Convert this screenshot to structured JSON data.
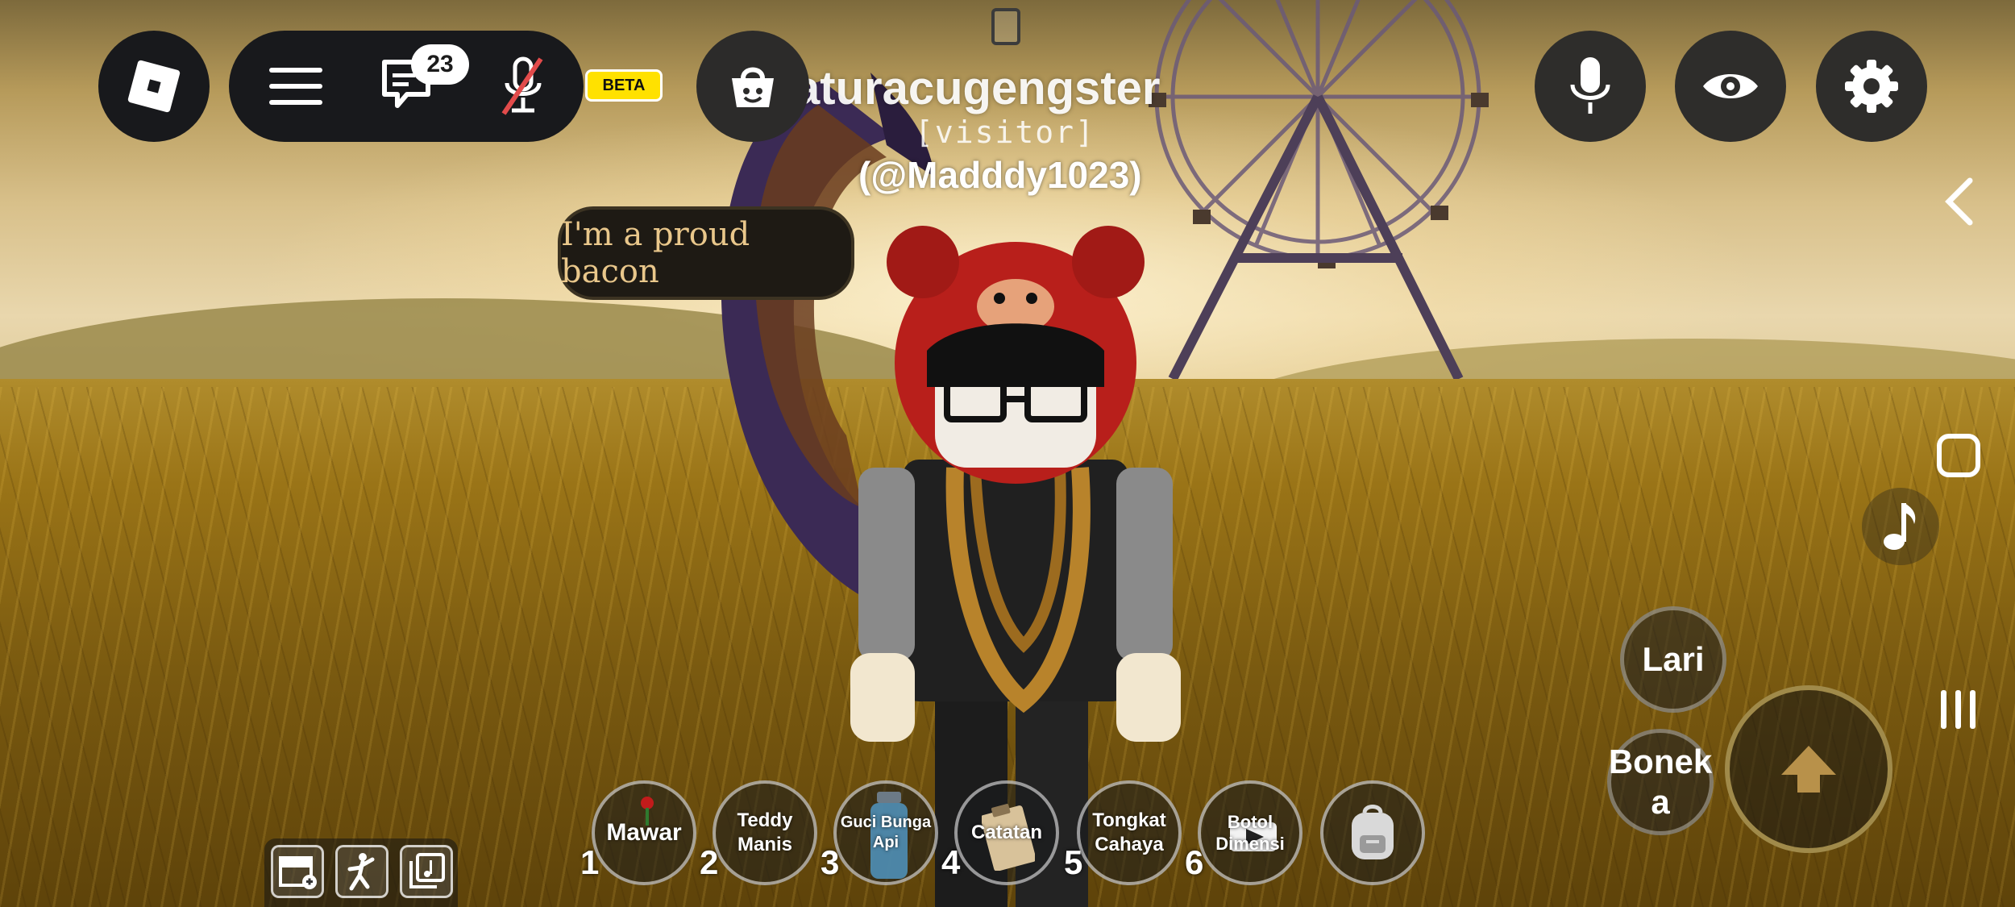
{
  "player": {
    "display_name": "aturacugengster",
    "role": "[visitor]",
    "handle": "(@Madddy1023)"
  },
  "chat_bubble": {
    "text": "I'm a proud bacon"
  },
  "topbar": {
    "chat_unread_count": "23",
    "beta_label": "BETA",
    "icons": [
      "roblox-logo-icon",
      "hamburger-menu-icon",
      "chat-icon",
      "muted-mic-icon",
      "shopping-bag-icon",
      "mic-icon",
      "eye-icon",
      "gear-icon"
    ]
  },
  "side_controls": {
    "icons": [
      "chevron-left-icon",
      "square-icon",
      "music-note-icon",
      "recent-apps-icon"
    ]
  },
  "actions": {
    "run_label": "Lari",
    "doll_label": "Bonek\na",
    "jump_icon": "up-arrow-icon"
  },
  "hotbar": [
    {
      "num": "1",
      "label": "Mawar",
      "icon": "rose-icon"
    },
    {
      "num": "2",
      "label": "Teddy Manis",
      "icon": ""
    },
    {
      "num": "3",
      "label": "Guci Bunga Api",
      "icon": "jar-icon"
    },
    {
      "num": "4",
      "label": "Catatan",
      "icon": "clipboard-icon"
    },
    {
      "num": "5",
      "label": "Tongkat Cahaya",
      "icon": ""
    },
    {
      "num": "6",
      "label": "Botol Dimensi",
      "icon": "bottle-icon"
    }
  ],
  "backpack_icon": "backpack-icon",
  "bottom_tray": {
    "icons": [
      "shop-add-icon",
      "emote-icon",
      "music-library-icon"
    ]
  },
  "colors": {
    "button_bg": "#18191c",
    "beta_yellow": "#ffe100",
    "jump_ring": "#a08a4a",
    "bubble_text": "#e9c78b"
  }
}
